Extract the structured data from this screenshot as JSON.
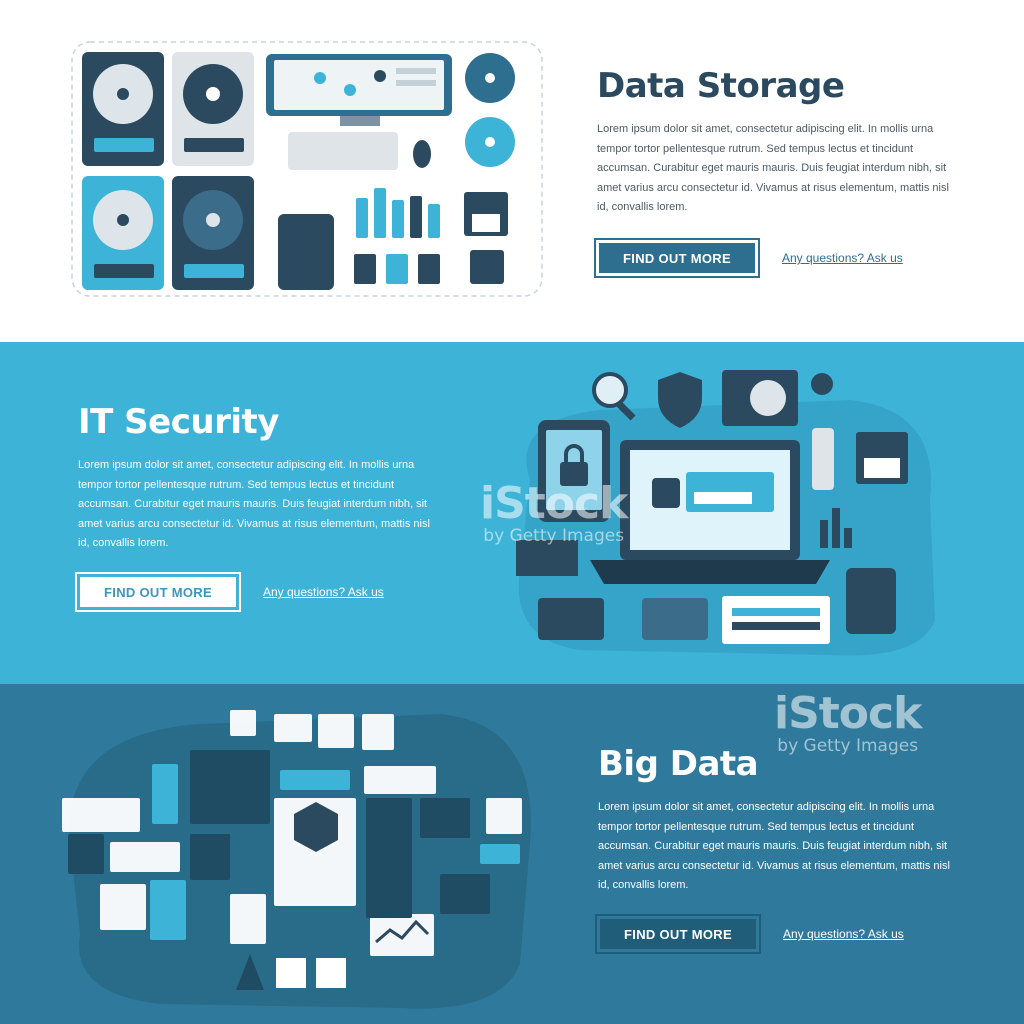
{
  "banners": {
    "storage": {
      "title": "Data Storage",
      "body": "Lorem ipsum dolor sit amet, consectetur adipiscing elit. In mollis urna tempor tortor pellentesque rutrum. Sed tempus lectus et tincidunt accumsan. Curabitur eget mauris mauris. Duis feugiat interdum nibh, sit amet varius arcu consectetur id. Vivamus at risus elementum, mattis nisl id, convallis lorem.",
      "button": "FIND OUT MORE",
      "link": "Any questions? Ask us",
      "bg_color": "#ffffff"
    },
    "security": {
      "title": "IT Security",
      "body": "Lorem ipsum dolor sit amet, consectetur adipiscing elit. In mollis urna tempor tortor pellentesque rutrum. Sed tempus lectus et tincidunt accumsan. Curabitur eget mauris mauris. Duis feugiat interdum nibh, sit amet varius arcu consectetur id. Vivamus at risus elementum, mattis nisl id, convallis lorem.",
      "button": "FIND OUT MORE",
      "link": "Any questions? Ask us",
      "bg_color": "#3db3d8"
    },
    "bigdata": {
      "title": "Big Data",
      "body": "Lorem ipsum dolor sit amet, consectetur adipiscing elit. In mollis urna tempor tortor pellentesque rutrum. Sed tempus lectus et tincidunt accumsan. Curabitur eget mauris mauris. Duis feugiat interdum nibh, sit amet varius arcu consectetur id. Vivamus at risus elementum, mattis nisl id, convallis lorem.",
      "button": "FIND OUT MORE",
      "link": "Any questions? Ask us",
      "bg_color": "#2f7a9c"
    }
  },
  "watermark": {
    "brand": "iStock",
    "byline": "by Getty Images"
  },
  "icons": [
    "hard-drive-icon",
    "monitor-icon",
    "keyboard-icon",
    "mouse-icon",
    "cd-icon",
    "external-drive-icon",
    "usb-stick-icon",
    "floppy-disk-icon",
    "sd-card-icon",
    "chip-icon",
    "laptop-icon",
    "padlock-icon",
    "shield-icon",
    "magnifier-icon",
    "key-icon",
    "gear-icon",
    "firewall-icon",
    "credit-card-icon",
    "bar-chart-icon",
    "hexagon-icon",
    "pyramid-icon",
    "line-chart-icon"
  ]
}
